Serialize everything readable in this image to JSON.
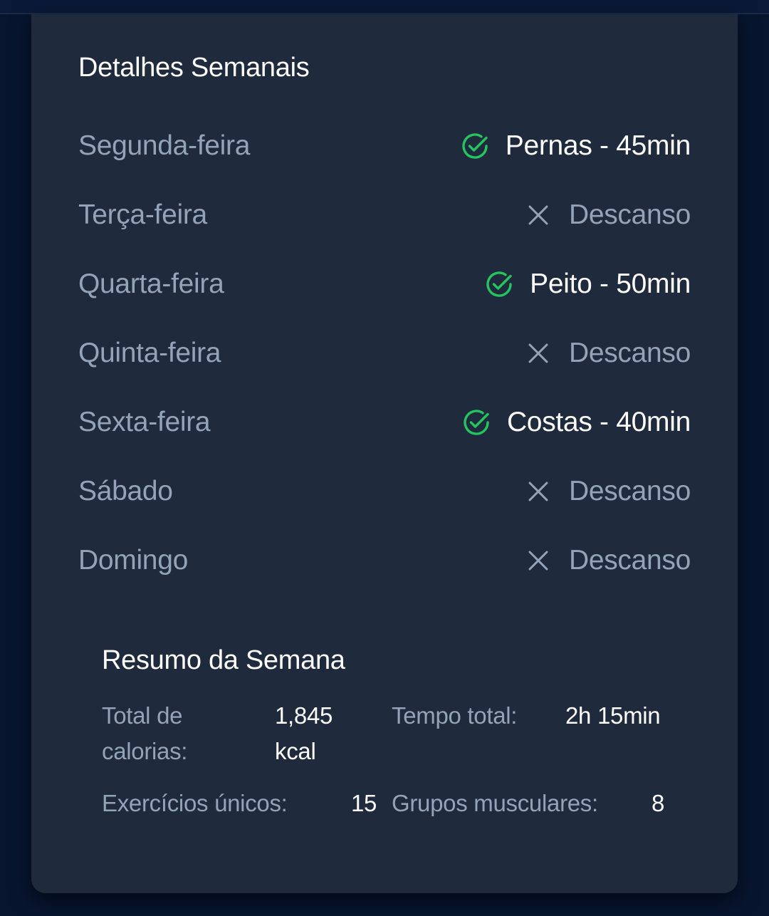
{
  "card": {
    "title": "Detalhes Semanais"
  },
  "days": [
    {
      "name": "Segunda-feira",
      "status": "done",
      "icon": "check-circle-icon",
      "text": "Pernas - 45min"
    },
    {
      "name": "Terça-feira",
      "status": "rest",
      "icon": "x-icon",
      "text": "Descanso"
    },
    {
      "name": "Quarta-feira",
      "status": "done",
      "icon": "check-circle-icon",
      "text": "Peito - 50min"
    },
    {
      "name": "Quinta-feira",
      "status": "rest",
      "icon": "x-icon",
      "text": "Descanso"
    },
    {
      "name": "Sexta-feira",
      "status": "done",
      "icon": "check-circle-icon",
      "text": "Costas - 40min"
    },
    {
      "name": "Sábado",
      "status": "rest",
      "icon": "x-icon",
      "text": "Descanso"
    },
    {
      "name": "Domingo",
      "status": "rest",
      "icon": "x-icon",
      "text": "Descanso"
    }
  ],
  "summary": {
    "title": "Resumo da Semana",
    "calories_label": "Total de calorias:",
    "calories_value": "1,845 kcal",
    "time_label": "Tempo total:",
    "time_value": "2h 15min",
    "exercises_label": "Exercícios únicos:",
    "exercises_value": "15",
    "muscles_label": "Grupos musculares:",
    "muscles_value": "8"
  },
  "colors": {
    "background": "#07152f",
    "card": "#1f2a3d",
    "accent_green": "#22c55e",
    "muted_text": "#94a3b8",
    "primary_text": "#ffffff"
  }
}
